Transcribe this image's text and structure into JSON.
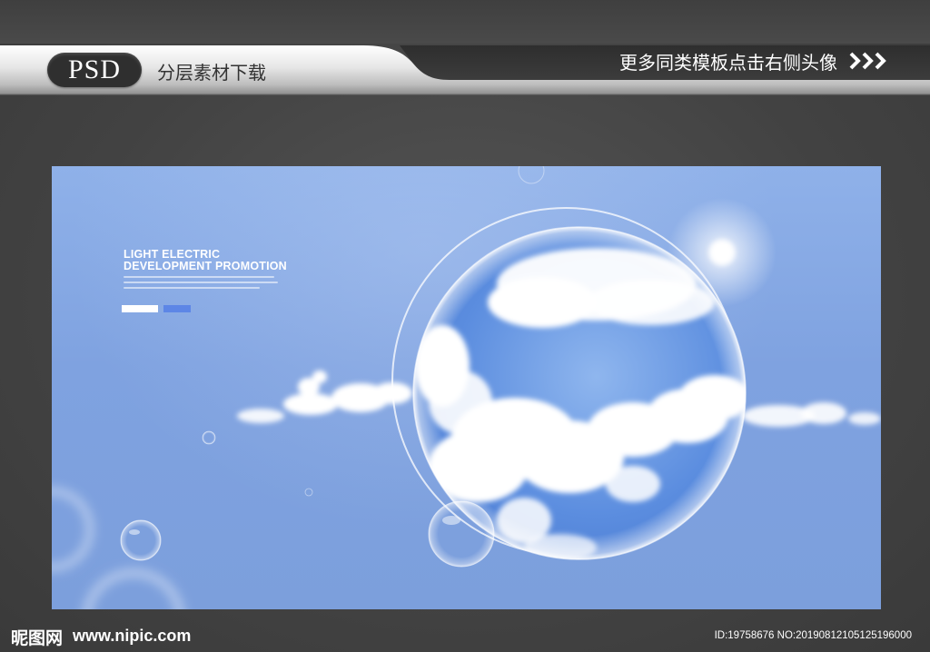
{
  "banner": {
    "badge": "PSD",
    "subtitle": "分层素材下载",
    "more_text": "更多同类模板点击右侧头像",
    "chevron_icon": "triple-chevron-right-icon"
  },
  "poster": {
    "headline_line1": "LIGHT ELECTRIC",
    "headline_line2": "DEVELOPMENT PROMOTION",
    "primary_button": "",
    "secondary_button": "",
    "colors": {
      "sky": "#85a8e4",
      "button_blue": "#5d86e6"
    }
  },
  "footer": {
    "logo": "昵图网",
    "url": "www.nipic.com",
    "id_text": "ID:19758676 NO:20190812105125196000"
  }
}
